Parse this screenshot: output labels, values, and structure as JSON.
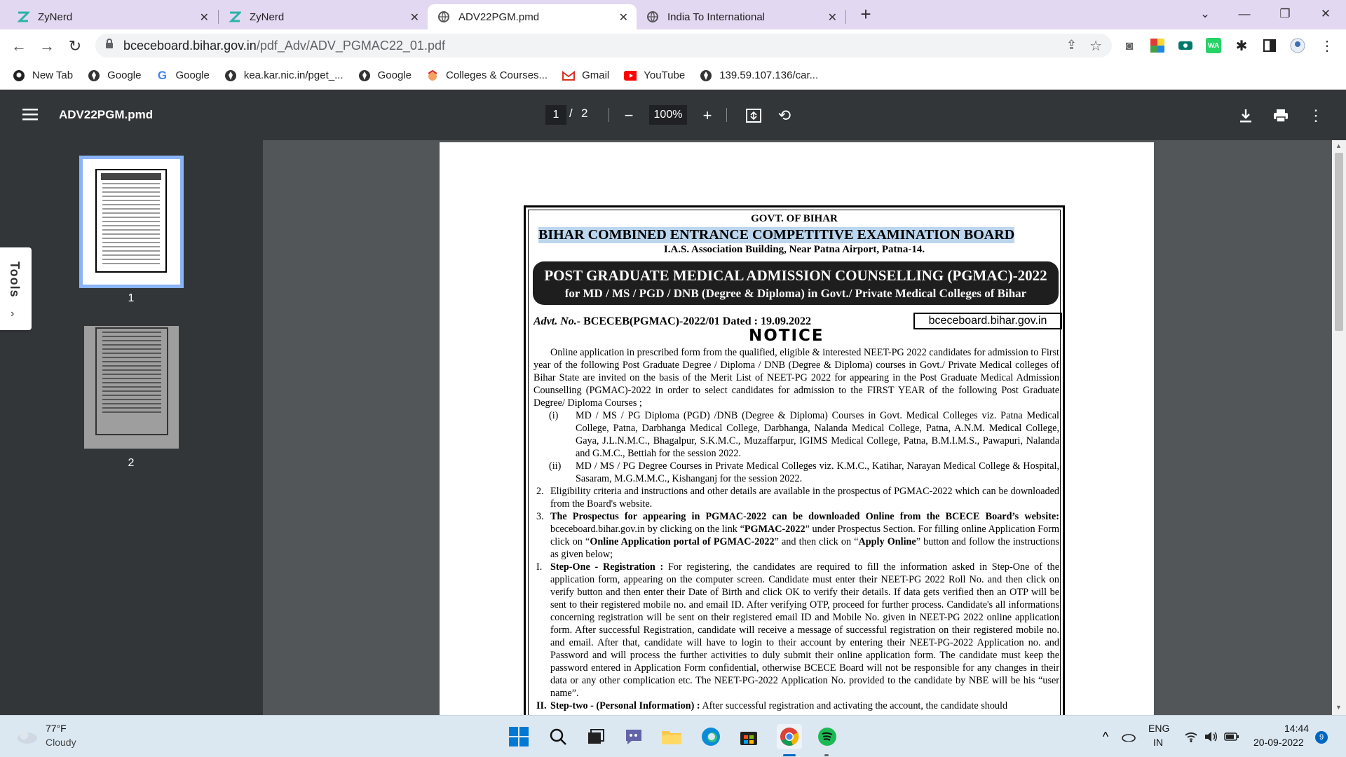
{
  "tabs": [
    {
      "title": "ZyNerd",
      "icon": "zynerd-icon"
    },
    {
      "title": "ZyNerd",
      "icon": "zynerd-icon"
    },
    {
      "title": "ADV22PGM.pmd",
      "icon": "globe-icon"
    },
    {
      "title": "India To International",
      "icon": "globe-icon"
    }
  ],
  "address": {
    "host": "bceceboard.bihar.gov.in",
    "path": "/pdf_Adv/ADV_PGMAC22_01.pdf"
  },
  "bookmarks": [
    {
      "label": "New Tab",
      "icon": "github-icon"
    },
    {
      "label": "Google",
      "icon": "globe-icon"
    },
    {
      "label": "Google",
      "icon": "google-icon"
    },
    {
      "label": "kea.kar.nic.in/pget_...",
      "icon": "globe-icon"
    },
    {
      "label": "Google",
      "icon": "globe-icon"
    },
    {
      "label": "Colleges & Courses...",
      "icon": "colleges-icon"
    },
    {
      "label": "Gmail",
      "icon": "gmail-icon"
    },
    {
      "label": "YouTube",
      "icon": "youtube-icon"
    },
    {
      "label": "139.59.107.136/car...",
      "icon": "globe-icon"
    }
  ],
  "pdf": {
    "title": "ADV22PGM.pmd",
    "current_page": "1",
    "page_sep": "/",
    "total_pages": "2",
    "zoom": "100%",
    "thumb1_label": "1",
    "thumb2_label": "2",
    "tools_label": "Tools",
    "tools_chevron": "›"
  },
  "doc": {
    "govt": "GOVT. OF BIHAR",
    "board": "BIHAR COMBINED ENTRANCE COMPETITIVE EXAMINATION BOARD",
    "address": "I.A.S. Association Building, Near Patna Airport, Patna-14.",
    "banner_title": "POST GRADUATE MEDICAL ADMISSION COUNSELLING (PGMAC)-2022",
    "banner_sub": "for MD / MS / PGD / DNB (Degree & Diploma)  in Govt./ Private Medical Colleges of Bihar",
    "advt_label": "Advt. No.-",
    "advt_value": "BCECEB(PGMAC)-2022/01 Dated : 19.09.2022",
    "website": "bceceboard.bihar.gov.in",
    "notice": "NOTICE",
    "intro": "Online application in prescribed form from the qualified, eligible & interested NEET-PG 2022 candidates for admission to First year of the following Post Graduate Degree / Diploma / DNB (Degree & Diploma) courses in Govt./ Private Medical colleges of Bihar State are invited on the basis of the Merit List of NEET-PG 2022 for appearing in the Post Graduate Medical Admission Counselling (PGMAC)-2022 in order to select candidates for admission to the FIRST YEAR of the following Post Graduate Degree/ Diploma Courses ;",
    "sub_i_num": "(i)",
    "sub_i": "MD / MS / PG Diploma (PGD) /DNB (Degree & Diploma) Courses in Govt. Medical Colleges viz. Patna Medical College, Patna, Darbhanga Medical College, Darbhanga, Nalanda Medical College, Patna, A.N.M. Medical College, Gaya, J.L.N.M.C., Bhagalpur, S.K.M.C., Muzaffarpur, IGIMS Medical College, Patna, B.M.I.M.S., Pawapuri, Nalanda and G.M.C., Bettiah for the session 2022.",
    "sub_ii_num": "(ii)",
    "sub_ii": "MD / MS / PG Degree Courses in Private Medical Colleges viz. K.M.C., Katihar, Narayan Medical College & Hospital, Sasaram, M.G.M.M.C., Kishanganj for the session 2022.",
    "p2_num": "2.",
    "p2": "Eligibility criteria and instructions and other details are available in the prospectus of PGMAC-2022 which can be downloaded from the Board's website.",
    "p3_num": "3.",
    "p3_bold": "The Prospectus for appearing in PGMAC-2022 can be downloaded Online from the BCECE Board’s website:",
    "p3_a": " bceceboard.bihar.gov.in by clicking on the link “",
    "p3_b": "PGMAC-2022",
    "p3_c": "” under Prospectus Section. For filling online Application Form click on “",
    "p3_d": "Online Application portal of PGMAC-2022",
    "p3_e": "” and then click on “",
    "p3_f": "Apply Online",
    "p3_g": "” button and follow the instructions as given below;",
    "s1_num": "I.",
    "s1_bold": "Step-One - Registration :",
    "s1": " For registering, the candidates are required to fill the information asked in Step-One of the application form, appearing on the computer screen. Candidate must enter their NEET-PG 2022 Roll No. and then click on verify button and then enter their Date of Birth and click OK to verify their details. If data gets verified then an OTP will be sent to their registered mobile no. and email ID. After verifying OTP, proceed for further process. Candidate's all informations concerning registration will be sent on their registered email ID and Mobile No. given in NEET-PG 2022 online application form. After successful Registration, candidate will receive a message of successful registration on their registered mobile no. and email. After that, candidate will have to login to their account by entering their NEET-PG-2022 Application no. and Password and will process the further activities to duly submit their online application form. The candidate must keep the password entered in Application Form confidential, otherwise BCECE Board will not be responsible for any changes in their data or any other complication etc. The NEET-PG-2022 Application No. provided to the candidate by NBE will be his “user name”.",
    "s2_num": "II.",
    "s2_bold": "Step-two - (Personal Information) :",
    "s2": " After successful registration and activating the account, the candidate should"
  },
  "taskbar": {
    "temp": "77°F",
    "weather": "Cloudy",
    "lang1": "ENG",
    "lang2": "IN",
    "time": "14:44",
    "date": "20-09-2022",
    "badge": "9"
  }
}
